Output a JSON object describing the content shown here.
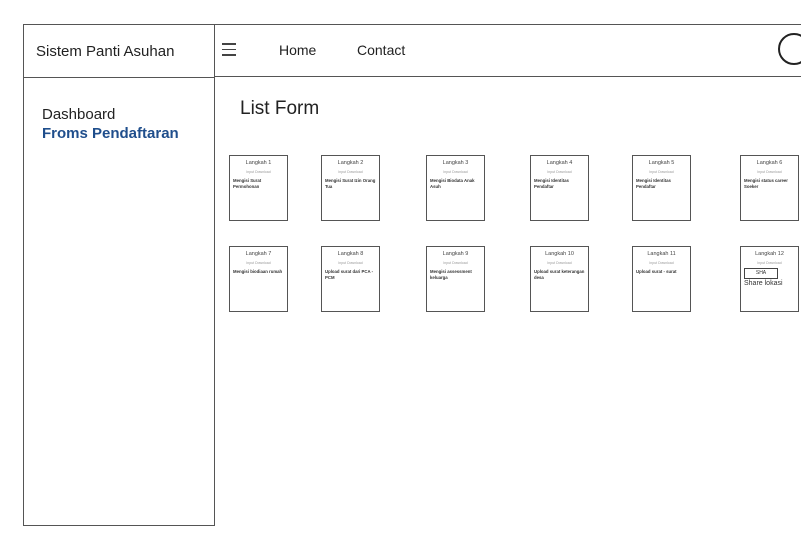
{
  "app": {
    "title": "Sistem Panti Asuhan"
  },
  "topnav": {
    "home": "Home",
    "contact": "Contact"
  },
  "sidebar": {
    "items": [
      {
        "label": "Dashboard",
        "active": false
      },
      {
        "label": "Froms Pendaftaran",
        "active": true
      }
    ]
  },
  "page": {
    "title": "List Form"
  },
  "cards": [
    {
      "step": "Langkah 1",
      "link": "Input Download",
      "desc": "Mengisi Surat Permohonan"
    },
    {
      "step": "Langkah 2",
      "link": "Input Download",
      "desc": "Mengisi Surat Izin Orang Tua"
    },
    {
      "step": "Langkah 3",
      "link": "Input Download",
      "desc": "Mengisi Biodata Anak Asuh"
    },
    {
      "step": "Langkah 4",
      "link": "Input Download",
      "desc": "Mengisi Identitas Pendaftar"
    },
    {
      "step": "Langkah 5",
      "link": "Input Download",
      "desc": "Mengisi Identitas Pendaftar"
    },
    {
      "step": "Langkah 6",
      "link": "Input Download",
      "desc": "Mengisi status career Soeker"
    },
    {
      "step": "Langkah 7",
      "link": "Input Download",
      "desc": "Mengisi biodiaan rumah"
    },
    {
      "step": "Langkah 8",
      "link": "Input Download",
      "desc": "Upload surat dari PCA - PCM"
    },
    {
      "step": "Langkah 9",
      "link": "Input Download",
      "desc": "Mengisi assessment keluarga"
    },
    {
      "step": "Langkah 10",
      "link": "Input Download",
      "desc": "Upload surat keterangan desa"
    },
    {
      "step": "Langkah 11",
      "link": "Input Download",
      "desc": "Upload surat - surat"
    },
    {
      "step": "Langkah 12",
      "link": "Input Download",
      "desc": "",
      "button": "SHA",
      "extra": "Share lokasi"
    }
  ]
}
